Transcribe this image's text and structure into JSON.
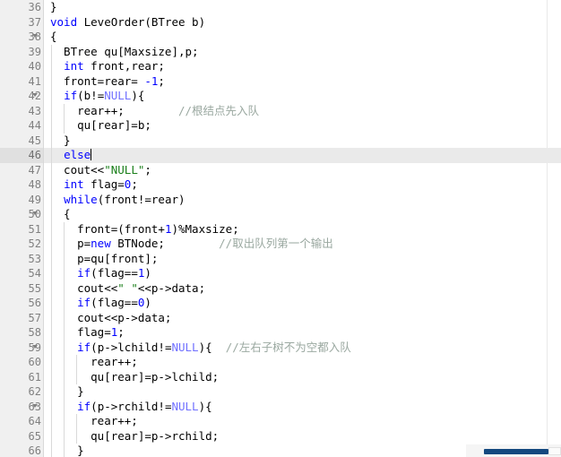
{
  "editor": {
    "language": "C++",
    "current_line": 46,
    "first_visible_line": 36,
    "last_visible_line": 66,
    "colors": {
      "background": "#ffffff",
      "gutter_background": "#f0f0f0",
      "line_number": "#808080",
      "current_line_highlight": "#eaeaea",
      "keyword": "#0000ff",
      "string": "#1a7f1a",
      "comment": "#9aa8a0",
      "plain_text": "#000000",
      "scrollbar_thumb": "#14487f",
      "indent_guide": "#d9d9d9"
    },
    "lines": [
      {
        "num": "36",
        "fold": false,
        "indent_guides": 0,
        "tokens": [
          {
            "t": "plain",
            "s": "}"
          }
        ]
      },
      {
        "num": "37",
        "fold": false,
        "indent_guides": 0,
        "tokens": [
          {
            "t": "kw",
            "s": "void"
          },
          {
            "t": "plain",
            "s": " LeveOrder(BTree b)"
          }
        ]
      },
      {
        "num": "38",
        "fold": true,
        "indent_guides": 0,
        "tokens": [
          {
            "t": "plain",
            "s": "{"
          }
        ]
      },
      {
        "num": "39",
        "fold": false,
        "indent_guides": 1,
        "tokens": [
          {
            "t": "plain",
            "s": "  BTree qu[Maxsize],p;"
          }
        ]
      },
      {
        "num": "40",
        "fold": false,
        "indent_guides": 1,
        "tokens": [
          {
            "t": "plain",
            "s": "  "
          },
          {
            "t": "kw",
            "s": "int"
          },
          {
            "t": "plain",
            "s": " front,rear;"
          }
        ]
      },
      {
        "num": "41",
        "fold": false,
        "indent_guides": 1,
        "tokens": [
          {
            "t": "plain",
            "s": "  front=rear= "
          },
          {
            "t": "num",
            "s": "-1"
          },
          {
            "t": "plain",
            "s": ";"
          }
        ]
      },
      {
        "num": "42",
        "fold": true,
        "indent_guides": 1,
        "tokens": [
          {
            "t": "plain",
            "s": "  "
          },
          {
            "t": "kw",
            "s": "if"
          },
          {
            "t": "plain",
            "s": "(b!="
          },
          {
            "t": "lit",
            "s": "NULL"
          },
          {
            "t": "plain",
            "s": "){"
          }
        ]
      },
      {
        "num": "43",
        "fold": false,
        "indent_guides": 2,
        "tokens": [
          {
            "t": "plain",
            "s": "    rear++;        "
          },
          {
            "t": "cmt",
            "s": "//根结点先入队"
          }
        ]
      },
      {
        "num": "44",
        "fold": false,
        "indent_guides": 2,
        "tokens": [
          {
            "t": "plain",
            "s": "    qu[rear]=b;"
          }
        ]
      },
      {
        "num": "45",
        "fold": false,
        "indent_guides": 1,
        "tokens": [
          {
            "t": "plain",
            "s": "  }"
          }
        ]
      },
      {
        "num": "46",
        "fold": false,
        "indent_guides": 1,
        "current": true,
        "cursor": true,
        "tokens": [
          {
            "t": "plain",
            "s": "  "
          },
          {
            "t": "kw",
            "s": "else"
          }
        ]
      },
      {
        "num": "47",
        "fold": false,
        "indent_guides": 1,
        "tokens": [
          {
            "t": "plain",
            "s": "  cout<<"
          },
          {
            "t": "str",
            "s": "\"NULL\""
          },
          {
            "t": "plain",
            "s": ";"
          }
        ]
      },
      {
        "num": "48",
        "fold": false,
        "indent_guides": 1,
        "tokens": [
          {
            "t": "plain",
            "s": "  "
          },
          {
            "t": "kw",
            "s": "int"
          },
          {
            "t": "plain",
            "s": " flag="
          },
          {
            "t": "num",
            "s": "0"
          },
          {
            "t": "plain",
            "s": ";"
          }
        ]
      },
      {
        "num": "49",
        "fold": false,
        "indent_guides": 1,
        "tokens": [
          {
            "t": "plain",
            "s": "  "
          },
          {
            "t": "kw",
            "s": "while"
          },
          {
            "t": "plain",
            "s": "(front!=rear)"
          }
        ]
      },
      {
        "num": "50",
        "fold": true,
        "indent_guides": 1,
        "tokens": [
          {
            "t": "plain",
            "s": "  {"
          }
        ]
      },
      {
        "num": "51",
        "fold": false,
        "indent_guides": 2,
        "tokens": [
          {
            "t": "plain",
            "s": "    front=(front+"
          },
          {
            "t": "num",
            "s": "1"
          },
          {
            "t": "plain",
            "s": ")%Maxsize;"
          }
        ]
      },
      {
        "num": "52",
        "fold": false,
        "indent_guides": 2,
        "tokens": [
          {
            "t": "plain",
            "s": "    p="
          },
          {
            "t": "kw",
            "s": "new"
          },
          {
            "t": "plain",
            "s": " BTNode;        "
          },
          {
            "t": "cmt",
            "s": "//取出队列第一个输出"
          }
        ]
      },
      {
        "num": "53",
        "fold": false,
        "indent_guides": 2,
        "tokens": [
          {
            "t": "plain",
            "s": "    p=qu[front];"
          }
        ]
      },
      {
        "num": "54",
        "fold": false,
        "indent_guides": 2,
        "tokens": [
          {
            "t": "plain",
            "s": "    "
          },
          {
            "t": "kw",
            "s": "if"
          },
          {
            "t": "plain",
            "s": "(flag=="
          },
          {
            "t": "num",
            "s": "1"
          },
          {
            "t": "plain",
            "s": ")"
          }
        ]
      },
      {
        "num": "55",
        "fold": false,
        "indent_guides": 2,
        "tokens": [
          {
            "t": "plain",
            "s": "    cout<<"
          },
          {
            "t": "str",
            "s": "\" \""
          },
          {
            "t": "plain",
            "s": "<<p->data;"
          }
        ]
      },
      {
        "num": "56",
        "fold": false,
        "indent_guides": 2,
        "tokens": [
          {
            "t": "plain",
            "s": "    "
          },
          {
            "t": "kw",
            "s": "if"
          },
          {
            "t": "plain",
            "s": "(flag=="
          },
          {
            "t": "num",
            "s": "0"
          },
          {
            "t": "plain",
            "s": ")"
          }
        ]
      },
      {
        "num": "57",
        "fold": false,
        "indent_guides": 2,
        "tokens": [
          {
            "t": "plain",
            "s": "    cout<<p->data;"
          }
        ]
      },
      {
        "num": "58",
        "fold": false,
        "indent_guides": 2,
        "tokens": [
          {
            "t": "plain",
            "s": "    flag="
          },
          {
            "t": "num",
            "s": "1"
          },
          {
            "t": "plain",
            "s": ";"
          }
        ]
      },
      {
        "num": "59",
        "fold": true,
        "indent_guides": 2,
        "tokens": [
          {
            "t": "plain",
            "s": "    "
          },
          {
            "t": "kw",
            "s": "if"
          },
          {
            "t": "plain",
            "s": "(p->lchild!="
          },
          {
            "t": "lit",
            "s": "NULL"
          },
          {
            "t": "plain",
            "s": "){  "
          },
          {
            "t": "cmt",
            "s": "//左右子树不为空都入队"
          }
        ]
      },
      {
        "num": "60",
        "fold": false,
        "indent_guides": 3,
        "tokens": [
          {
            "t": "plain",
            "s": "      rear++;"
          }
        ]
      },
      {
        "num": "61",
        "fold": false,
        "indent_guides": 3,
        "tokens": [
          {
            "t": "plain",
            "s": "      qu[rear]=p->lchild;"
          }
        ]
      },
      {
        "num": "62",
        "fold": false,
        "indent_guides": 2,
        "tokens": [
          {
            "t": "plain",
            "s": "    }"
          }
        ]
      },
      {
        "num": "63",
        "fold": true,
        "indent_guides": 2,
        "tokens": [
          {
            "t": "plain",
            "s": "    "
          },
          {
            "t": "kw",
            "s": "if"
          },
          {
            "t": "plain",
            "s": "(p->rchild!="
          },
          {
            "t": "lit",
            "s": "NULL"
          },
          {
            "t": "plain",
            "s": "){"
          }
        ]
      },
      {
        "num": "64",
        "fold": false,
        "indent_guides": 3,
        "tokens": [
          {
            "t": "plain",
            "s": "      rear++;"
          }
        ]
      },
      {
        "num": "65",
        "fold": false,
        "indent_guides": 3,
        "tokens": [
          {
            "t": "plain",
            "s": "      qu[rear]=p->rchild;"
          }
        ]
      },
      {
        "num": "66",
        "fold": false,
        "indent_guides": 2,
        "tokens": [
          {
            "t": "plain",
            "s": "    }"
          }
        ]
      }
    ]
  }
}
